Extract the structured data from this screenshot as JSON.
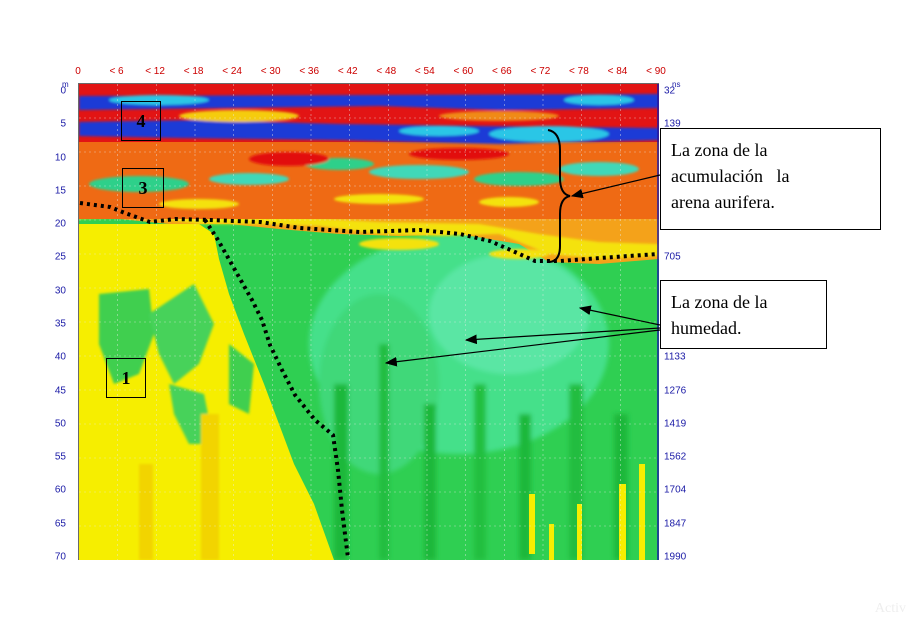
{
  "x_axis": {
    "ticks": [
      "0",
      "< 6",
      "< 12",
      "< 18",
      "< 24",
      "< 30",
      "< 36",
      "< 42",
      "< 48",
      "< 54",
      "< 60",
      "< 66",
      "< 72",
      "< 78",
      "< 84",
      "< 90"
    ]
  },
  "y_axis_left": {
    "unit": "m",
    "ticks": [
      "0",
      "5",
      "10",
      "15",
      "20",
      "25",
      "30",
      "35",
      "40",
      "45",
      "50",
      "55",
      "60",
      "65",
      "70"
    ]
  },
  "y_axis_right": {
    "unit": "ns",
    "ticks": [
      "32",
      "139",
      "705",
      "1133",
      "1276",
      "1419",
      "1562",
      "1704",
      "1847",
      "1990"
    ]
  },
  "zones": {
    "z4": "4",
    "z3": "3",
    "z1": "1"
  },
  "notes": {
    "gold_sand": {
      "line1": "La zona de la",
      "line2": "acumulación   la",
      "line3": "arena aurifera."
    },
    "moisture": {
      "line1": "La zona de la",
      "line2": "humedad."
    }
  },
  "colors": {
    "deep_blue": "#1e3bd6",
    "red": "#e8141a",
    "orange": "#f07a1a",
    "yellow": "#f6f000",
    "green": "#25c43c",
    "light_green": "#3fdc7a",
    "cyan": "#3ad8d8"
  },
  "watermark": "Activ"
}
